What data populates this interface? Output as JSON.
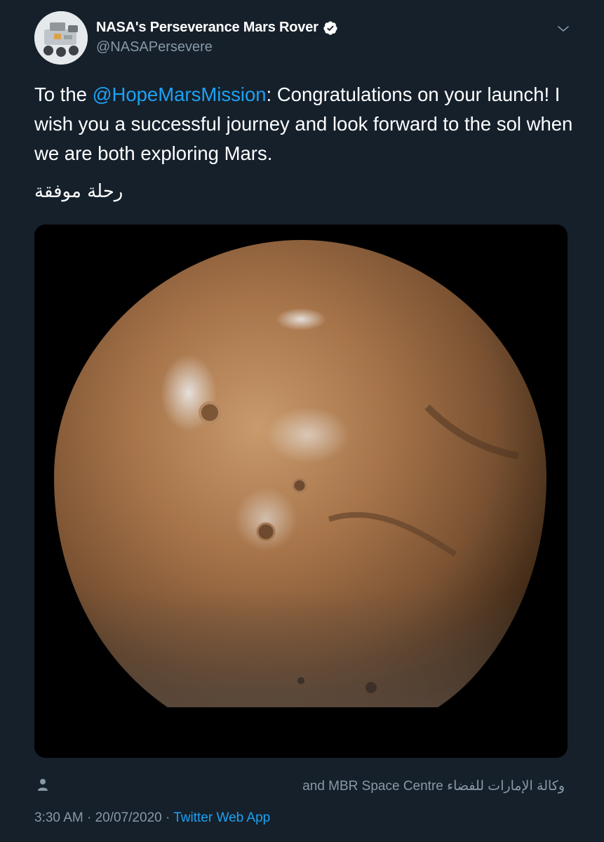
{
  "author": {
    "display_name": "NASA's Perseverance Mars Rover",
    "handle": "@NASAPersevere",
    "verified": true,
    "avatar_icon": "rover-avatar-icon"
  },
  "tweet": {
    "text_prefix": "To the ",
    "mention": "@HopeMarsMission",
    "text_suffix": ": Congratulations on your launch! I wish you a successful journey and look forward to the sol when we are both exploring Mars.",
    "arabic_line": "رحلة موفقة"
  },
  "media": {
    "subject_icon": "mars-planet-image"
  },
  "media_credit": {
    "text": "وكالة الإمارات للفضاء and MBR Space Centre",
    "icon": "person-icon"
  },
  "meta": {
    "time": "3:30 AM",
    "separator": "·",
    "date": "20/07/2020",
    "source": "Twitter Web App"
  },
  "colors": {
    "background": "#15202b",
    "link": "#1da1f2",
    "secondary_text": "#8899a6",
    "verified_badge": "#ffffff"
  }
}
